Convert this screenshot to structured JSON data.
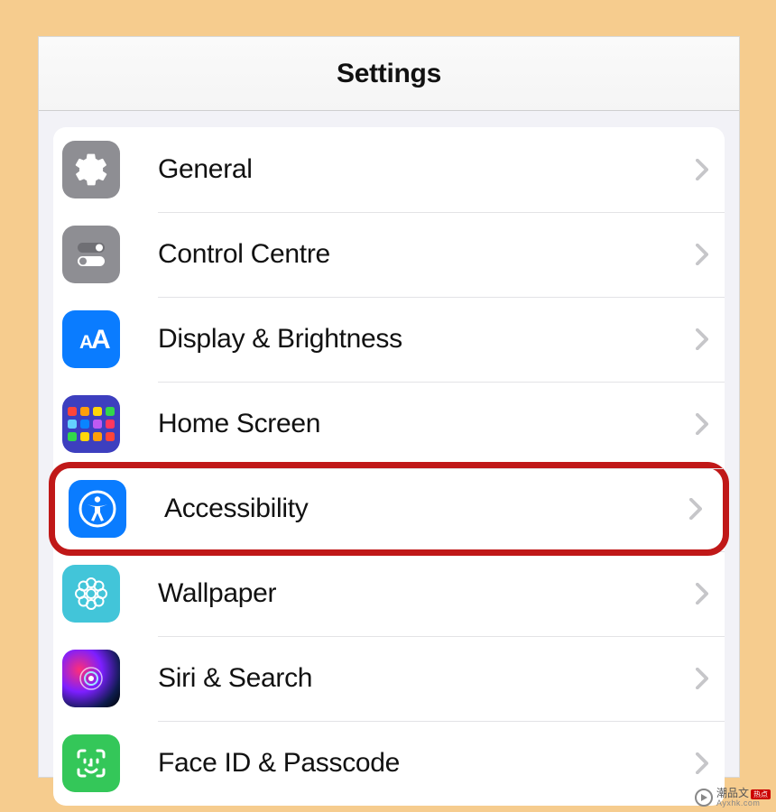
{
  "header": {
    "title": "Settings"
  },
  "list": {
    "items": [
      {
        "id": "general",
        "label": "General",
        "icon": "gear-icon",
        "highlighted": false
      },
      {
        "id": "control-centre",
        "label": "Control Centre",
        "icon": "toggles-icon",
        "highlighted": false
      },
      {
        "id": "display-brightness",
        "label": "Display & Brightness",
        "icon": "text-size-icon",
        "highlighted": false
      },
      {
        "id": "home-screen",
        "label": "Home Screen",
        "icon": "app-grid-icon",
        "highlighted": false
      },
      {
        "id": "accessibility",
        "label": "Accessibility",
        "icon": "accessibility-icon",
        "highlighted": true
      },
      {
        "id": "wallpaper",
        "label": "Wallpaper",
        "icon": "flower-icon",
        "highlighted": false
      },
      {
        "id": "siri-search",
        "label": "Siri & Search",
        "icon": "siri-icon",
        "highlighted": false
      },
      {
        "id": "face-id-passcode",
        "label": "Face ID & Passcode",
        "icon": "face-id-icon",
        "highlighted": false
      }
    ]
  },
  "watermark": {
    "line1": "潮品文",
    "line2": "Ayxhk.com",
    "badge": "热点"
  }
}
